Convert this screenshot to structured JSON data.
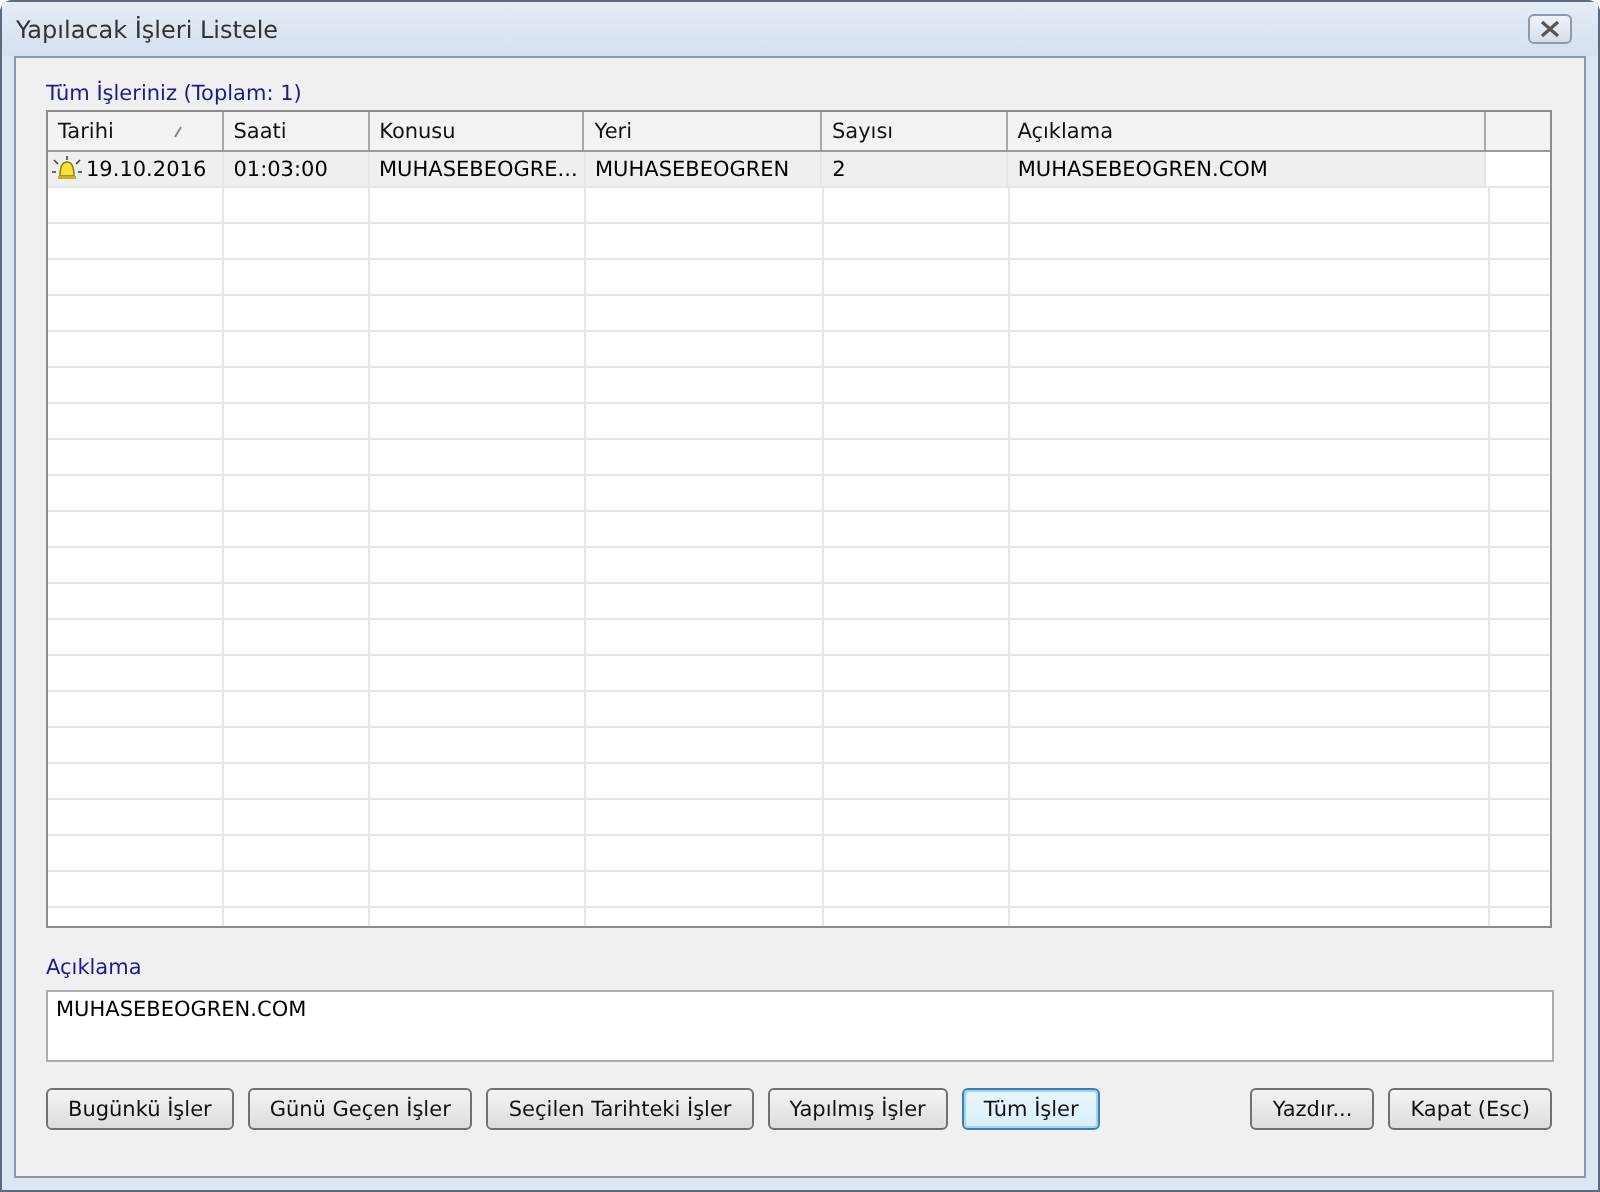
{
  "window": {
    "title": "Yapılacak İşleri Listele"
  },
  "list_label": "Tüm İşleriniz (Toplam: 1)",
  "table": {
    "columns": [
      {
        "label": "Tarihi",
        "sorted": true
      },
      {
        "label": "Saati",
        "sorted": false
      },
      {
        "label": "Konusu",
        "sorted": false
      },
      {
        "label": "Yeri",
        "sorted": false
      },
      {
        "label": "Sayısı",
        "sorted": false
      },
      {
        "label": "Açıklama",
        "sorted": false
      }
    ],
    "rows": [
      {
        "selected": true,
        "alarm": true,
        "cells": [
          "19.10.2016",
          "01:03:00",
          "MUHASEBEOGRE...",
          "MUHASEBEOGREN",
          "2",
          "MUHASEBEOGREN.COM"
        ]
      }
    ]
  },
  "description": {
    "label": "Açıklama",
    "value": "MUHASEBEOGREN.COM"
  },
  "filter_buttons": [
    {
      "label": "Bugünkü İşler",
      "default": false
    },
    {
      "label": "Günü Geçen İşler",
      "default": false
    },
    {
      "label": "Seçilen Tarihteki İşler",
      "default": false
    },
    {
      "label": "Yapılmış İşler",
      "default": false
    },
    {
      "label": "Tüm İşler",
      "default": true
    }
  ],
  "dialog_buttons": [
    {
      "label": "Yazdır...",
      "default": false
    },
    {
      "label": "Kapat (Esc)",
      "default": false
    }
  ]
}
